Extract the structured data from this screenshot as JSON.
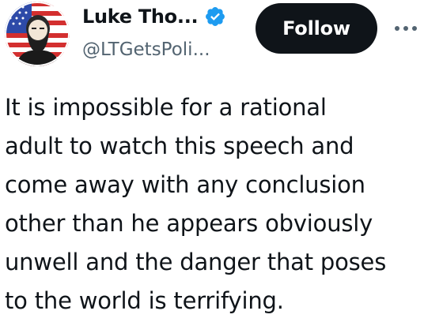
{
  "author": {
    "display_name": "Luke Tho...",
    "handle": "@LTGetsPoli...",
    "verified_icon": "verified-badge-icon",
    "verified_color": "#1d9bf0",
    "avatar_icon": "bearded-man-avatar-icon"
  },
  "actions": {
    "follow_label": "Follow",
    "more_icon": "more-horizontal-icon"
  },
  "tweet": {
    "lines": [
      "It is impossible for a rational",
      "adult to watch this speech and",
      "come away with any conclusion",
      "other than he appears obviously",
      "unwell and the danger that poses",
      "to the world is terrifying."
    ]
  },
  "colors": {
    "text": "#0f1419",
    "secondary_text": "#536471",
    "follow_bg": "#0f1419",
    "follow_text": "#ffffff"
  }
}
